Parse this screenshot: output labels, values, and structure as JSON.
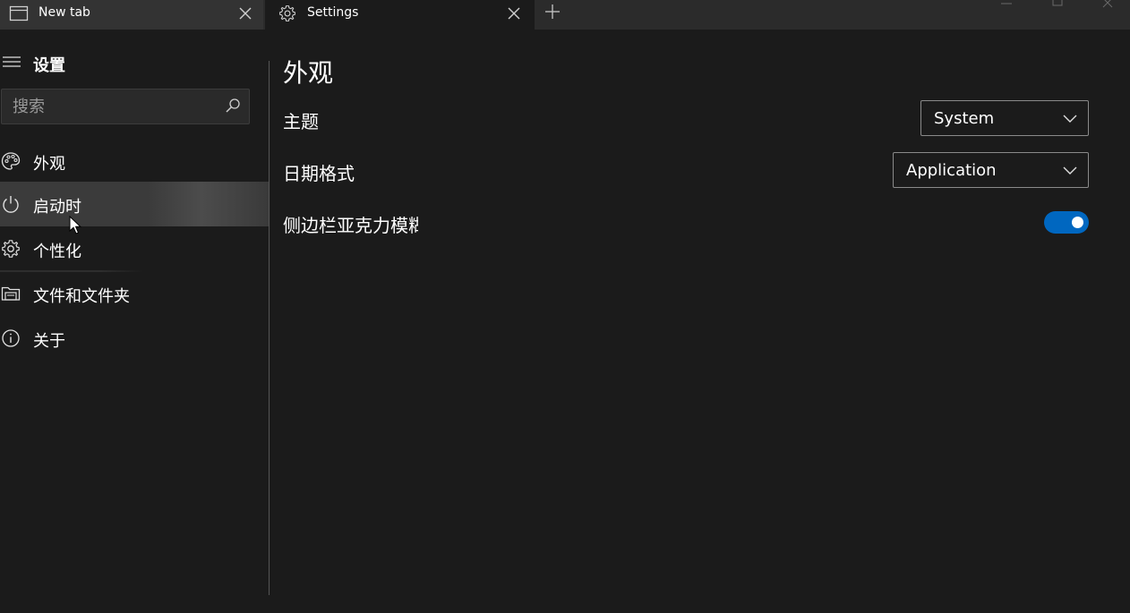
{
  "tabs": [
    {
      "label": "New tab",
      "icon": "window-icon",
      "active": false
    },
    {
      "label": "Settings",
      "icon": "gear-icon",
      "active": true
    }
  ],
  "sidebar": {
    "title": "设置",
    "search_placeholder": "搜索",
    "items": [
      {
        "label": "外观",
        "icon": "palette-icon"
      },
      {
        "label": "启动时",
        "icon": "power-icon",
        "hovered": true
      },
      {
        "label": "个性化",
        "icon": "gear-icon"
      },
      {
        "label": "文件和文件夹",
        "icon": "folder-icon"
      },
      {
        "label": "关于",
        "icon": "info-icon"
      }
    ]
  },
  "main": {
    "title": "外观",
    "settings": {
      "theme": {
        "label": "主题",
        "value": "System"
      },
      "date_format": {
        "label": "日期格式",
        "value": "Application"
      },
      "sidebar_acrylic": {
        "label": "侧边栏亚克力模糊",
        "enabled": true
      }
    }
  },
  "colors": {
    "background": "#1b1b1b",
    "tabbar": "#2b2b2b",
    "accent": "#0067c0"
  }
}
